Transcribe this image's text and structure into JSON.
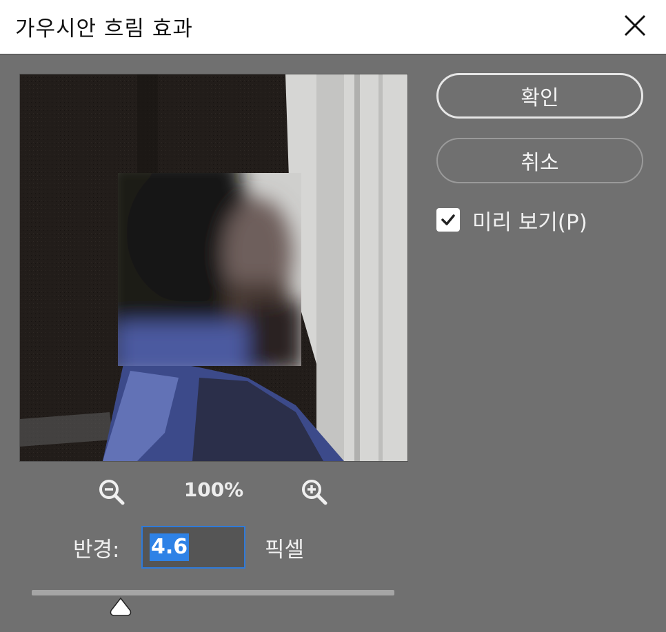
{
  "window": {
    "title": "가우시안 흐림 효과"
  },
  "preview": {
    "zoom_level": "100%"
  },
  "radius": {
    "label": "반경:",
    "value": "4.6",
    "unit": "픽셀",
    "slider_fraction": 0.245
  },
  "buttons": {
    "ok": "확인",
    "cancel": "취소"
  },
  "preview_toggle": {
    "label": "미리 보기(P)",
    "checked": true
  },
  "icons": [
    "close-icon",
    "zoom-out-icon",
    "zoom-in-icon",
    "check-icon",
    "slider-thumb-icon"
  ],
  "colors": {
    "selection": "#2e82e6",
    "dialog_bg": "#707070",
    "focus_border": "#2f7ad9"
  }
}
